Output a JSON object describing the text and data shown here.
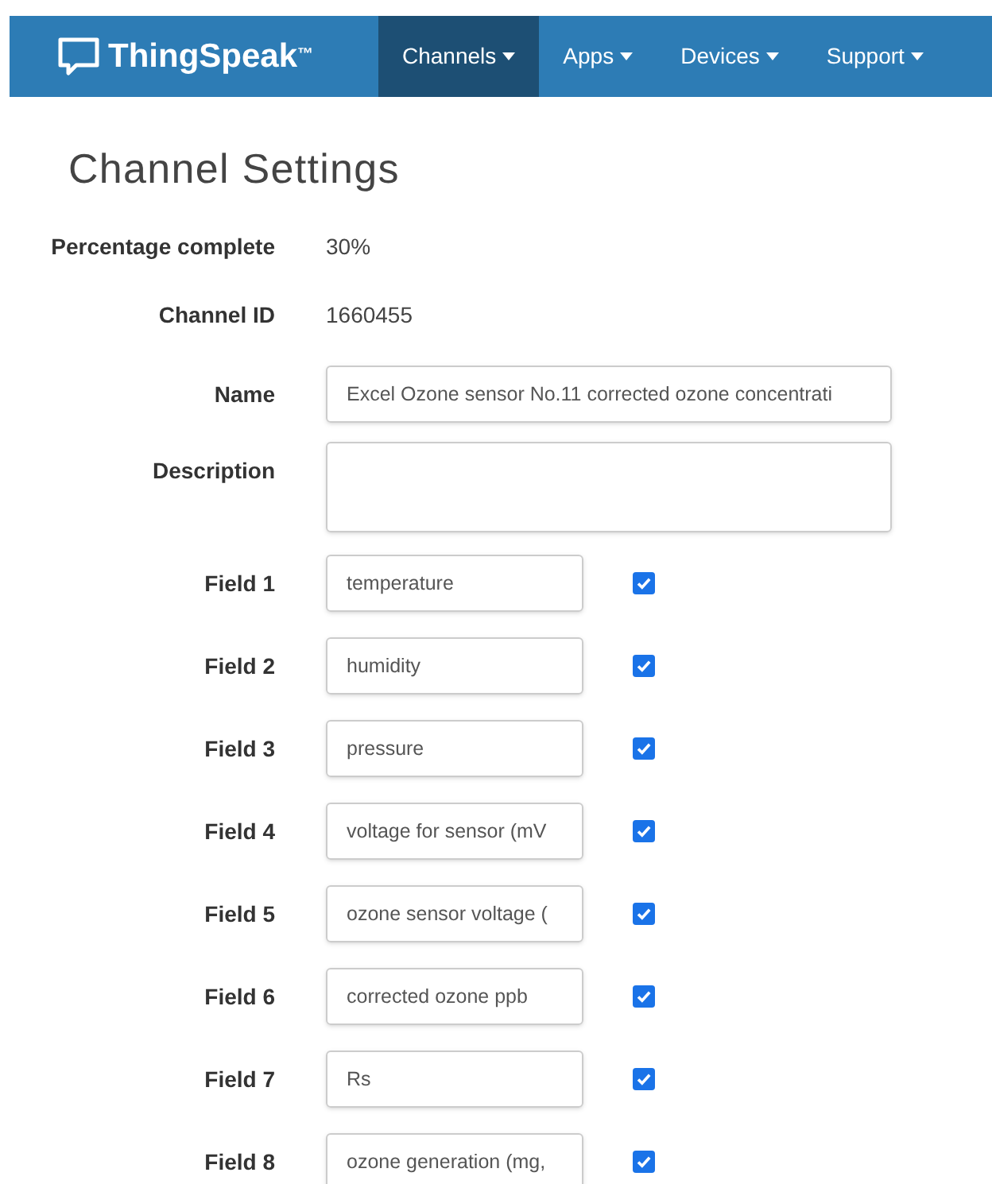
{
  "navbar": {
    "logo": "ThingSpeak$^{™}$",
    "menus": [
      {
        "label": "Channels",
        "selected": true
      },
      {
        "label": "Apps",
        "selected": false
      },
      {
        "label": "Devices",
        "selected": false
      },
      {
        "label": "Support",
        "selected": false
      }
    ]
  },
  "title": "Channel Settings",
  "info": [
    {
      "label": "Percentage complete",
      "value": "30%"
    },
    {
      "label": "Channel ID",
      "value": "1660455"
    }
  ],
  "name": {
    "label": "Name",
    "value": "Excel Ozone sensor No.11 corrected ozone concentrati"
  },
  "description": {
    "label": "Description"
  },
  "fields": [
    {
      "label": "Field 1",
      "value": "temperature",
      "checked": true
    },
    {
      "label": "Field 2",
      "value": "humidity",
      "checked": true
    },
    {
      "label": "Field 3",
      "value": "pressure",
      "checked": true
    },
    {
      "label": "Field 4",
      "value": "voltage for sensor (mV",
      "checked": true
    },
    {
      "label": "Field 5",
      "value": "ozone sensor voltage (",
      "checked": true
    },
    {
      "label": "Field 6",
      "value": "corrected ozone ppb",
      "checked": true
    },
    {
      "label": "Field 7",
      "value": "Rs",
      "checked": true
    },
    {
      "label": "Field 8",
      "value": "ozone generation (mg,",
      "checked": true
    }
  ]
}
